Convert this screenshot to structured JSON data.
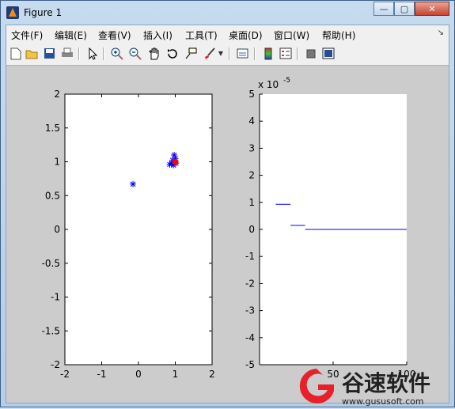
{
  "window": {
    "title": "Figure 1",
    "min_label": "—",
    "max_label": "▢",
    "close_label": "✕"
  },
  "menu": [
    "文件(F)",
    "编辑(E)",
    "查看(V)",
    "插入(I)",
    "工具(T)",
    "桌面(D)",
    "窗口(W)",
    "帮助(H)"
  ],
  "toolbar": [
    "new-icon",
    "open-icon",
    "save-icon",
    "print-icon",
    "pointer-icon",
    "zoom-in-icon",
    "zoom-out-icon",
    "pan-icon",
    "rotate-icon",
    "data-cursor-icon",
    "brush-icon",
    "link-icon",
    "colorbar-icon",
    "legend-icon",
    "hide-tools-icon",
    "show-tools-icon"
  ],
  "chart_data": [
    {
      "type": "scatter",
      "xlim": [
        -2,
        2
      ],
      "ylim": [
        -2,
        2
      ],
      "xticks": [
        "-2",
        "-1",
        "0",
        "1",
        "2"
      ],
      "yticks": [
        "2",
        "1.5",
        "1",
        "0.5",
        "0",
        "-0.5",
        "-1",
        "-1.5",
        "-2"
      ],
      "series": [
        {
          "marker": "asterisk",
          "color": "#0000ff",
          "points": [
            [
              -0.15,
              0.67
            ],
            [
              0.85,
              0.96
            ],
            [
              0.9,
              0.98
            ],
            [
              0.95,
              0.95
            ],
            [
              0.97,
              1.1
            ],
            [
              1.0,
              1.05
            ],
            [
              0.93,
              1.02
            ],
            [
              1.02,
              0.98
            ]
          ]
        },
        {
          "marker": "circle",
          "color": "#ff0000",
          "points": [
            [
              1.0,
              1.0
            ]
          ]
        }
      ]
    },
    {
      "type": "line",
      "xlim": [
        0,
        100
      ],
      "ylim": [
        -5,
        5
      ],
      "exponent_label": "x 10",
      "exponent_power": "-5",
      "xticks": [
        "50",
        "100"
      ],
      "yticks": [
        "5",
        "4",
        "3",
        "2",
        "1",
        "0",
        "-1",
        "-2",
        "-3",
        "-4",
        "-5"
      ],
      "series": [
        {
          "color": "#0000ff",
          "segments": [
            [
              [
                11,
                0.93
              ],
              [
                21,
                0.93
              ]
            ],
            [
              [
                21,
                0.15
              ],
              [
                31,
                0.15
              ]
            ],
            [
              [
                31,
                0.0
              ],
              [
                100,
                0.0
              ]
            ]
          ]
        }
      ]
    }
  ],
  "watermark": {
    "brand": "谷速软件",
    "url": "www.gususoft.com",
    "colors": {
      "red": "#e8202a",
      "dark": "#222222"
    }
  }
}
